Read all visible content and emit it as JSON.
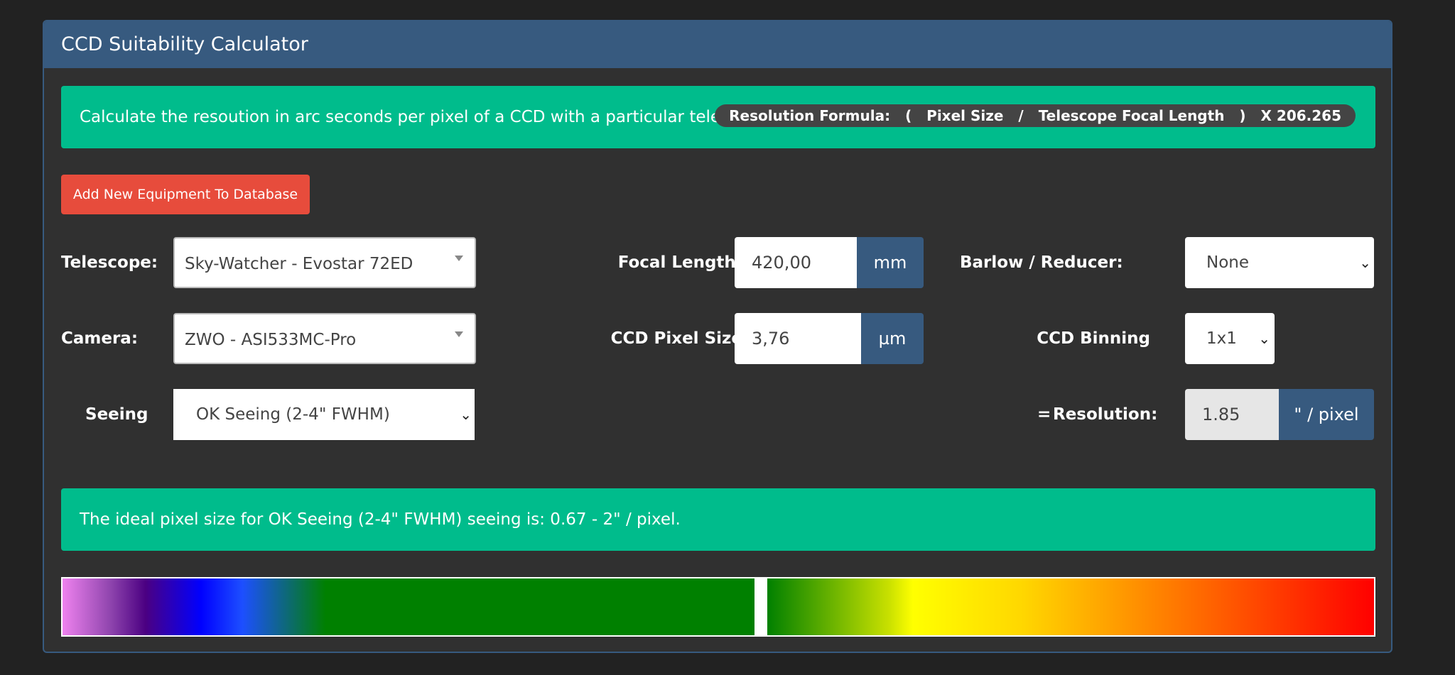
{
  "panel": {
    "title": "CCD Suitability Calculator"
  },
  "info": {
    "text": "Calculate the resoution in arc seconds per pixel of a CCD with a particular telescope.",
    "formula_parts": [
      "Resolution Formula:",
      "(",
      "Pixel Size",
      "/",
      "Telescope Focal Length",
      ")",
      "X 206.265"
    ]
  },
  "add_button": {
    "label": "Add New Equipment To Database"
  },
  "telescope": {
    "label": "Telescope:",
    "value": "Sky-Watcher - Evostar 72ED"
  },
  "focal_length": {
    "label": "Focal Length:",
    "value": "420,00",
    "unit": "mm"
  },
  "barlow": {
    "label": "Barlow / Reducer:",
    "value": "None"
  },
  "camera": {
    "label": "Camera:",
    "value": "ZWO - ASI533MC-Pro"
  },
  "pixel_size": {
    "label": "CCD Pixel Size",
    "value": "3,76",
    "unit": "µm"
  },
  "binning": {
    "label": "CCD Binning",
    "value": "1x1"
  },
  "seeing": {
    "label": "Seeing",
    "value": "OK Seeing (2-4\" FWHM)"
  },
  "resolution": {
    "equals": "=",
    "label": "Resolution:",
    "value": "1.85",
    "unit": "\" / pixel"
  },
  "ideal": {
    "text": "The ideal pixel size for OK Seeing (2-4\" FWHM) seeing is: 0.67 - 2\" / pixel."
  },
  "scale": {
    "marker_fraction": 0.533
  },
  "colors": {
    "primary": "#375a7f",
    "success": "#00bc8c",
    "danger": "#e74c3c",
    "panel_bg": "#303030",
    "page_bg": "#222222"
  }
}
